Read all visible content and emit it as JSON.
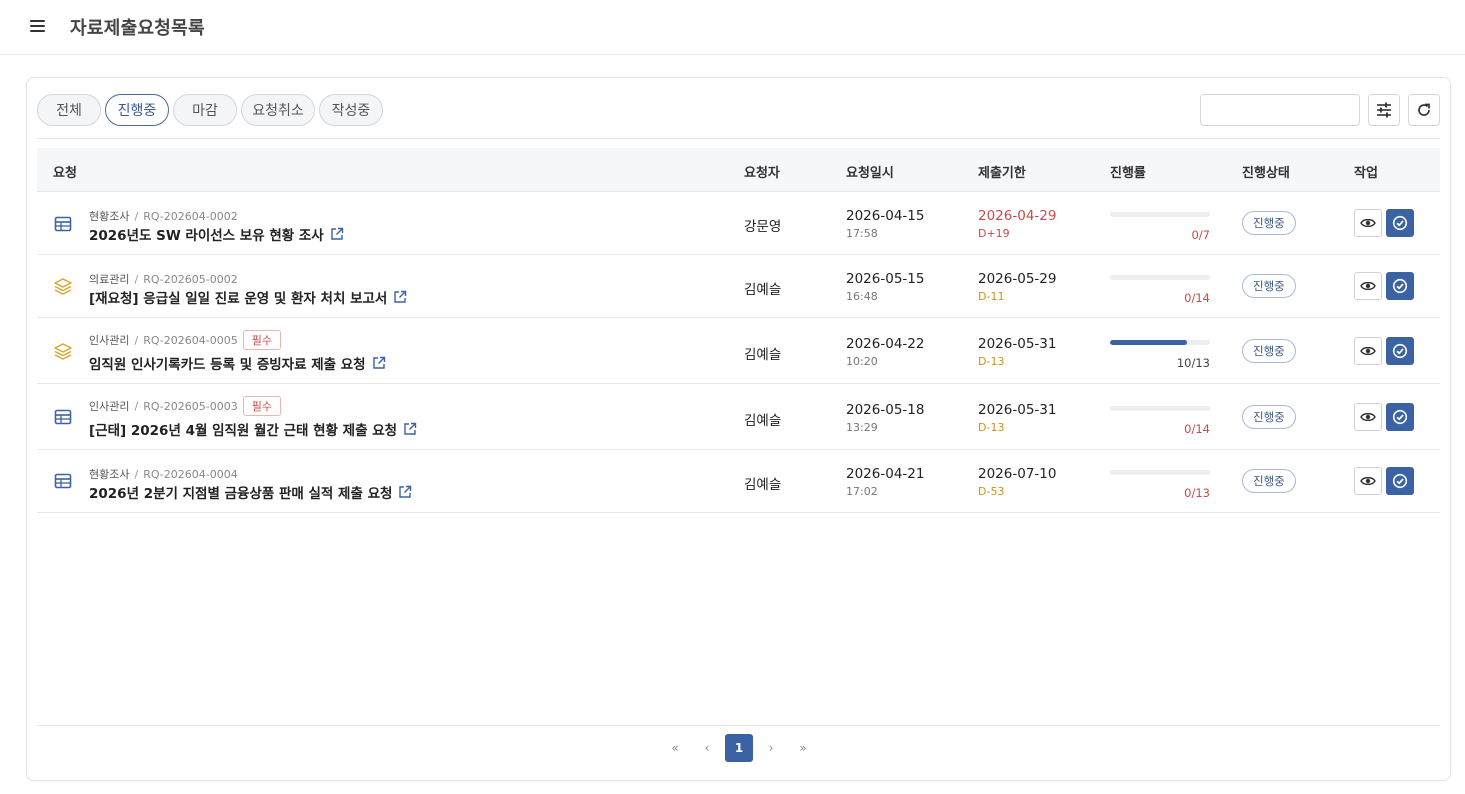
{
  "header": {
    "title": "자료제출요청목록"
  },
  "filters": [
    {
      "label": "전체",
      "active": false
    },
    {
      "label": "진행중",
      "active": true
    },
    {
      "label": "마감",
      "active": false
    },
    {
      "label": "요청취소",
      "active": false
    },
    {
      "label": "작성중",
      "active": false
    }
  ],
  "search": {
    "value": "",
    "placeholder": ""
  },
  "table": {
    "headers": {
      "request": "요청",
      "requester": "요청자",
      "requested_at": "요청일시",
      "deadline": "제출기한",
      "progress": "진행률",
      "status": "진행상태",
      "actions": "작업"
    },
    "rows": [
      {
        "icon": "table-icon",
        "category": "현황조사",
        "code": "RQ-202604-0002",
        "required": "",
        "title": "2026년도 SW 라이선스 보유 현황 조사",
        "requester": "강문영",
        "date": "2026-04-15",
        "time": "17:58",
        "deadline": "2026-04-29",
        "dday": "D+19",
        "progress_text": "0/7",
        "progress": 0,
        "status": "진행중"
      },
      {
        "icon": "layers-icon",
        "category": "의료관리",
        "code": "RQ-202605-0002",
        "required": "",
        "title": "[재요청] 응급실 일일 진료 운영 및 환자 처치 보고서",
        "requester": "김예슬",
        "date": "2026-05-15",
        "time": "16:48",
        "deadline": "2026-05-29",
        "dday": "D-11",
        "progress_text": "0/14",
        "progress": 0,
        "status": "진행중"
      },
      {
        "icon": "layers-icon",
        "category": "인사관리",
        "code": "RQ-202604-0005",
        "required": "필수",
        "title": "임직원 인사기록카드 등록 및 증빙자료 제출 요청",
        "requester": "김예슬",
        "date": "2026-04-22",
        "time": "10:20",
        "deadline": "2026-05-31",
        "dday": "D-13",
        "progress_text": "10/13",
        "progress": 0.769,
        "status": "진행중"
      },
      {
        "icon": "table-icon",
        "category": "인사관리",
        "code": "RQ-202605-0003",
        "required": "필수",
        "title": "[근태] 2026년 4월 임직원 월간 근태 현황 제출 요청",
        "requester": "김예슬",
        "date": "2026-05-18",
        "time": "13:29",
        "deadline": "2026-05-31",
        "dday": "D-13",
        "progress_text": "0/14",
        "progress": 0,
        "status": "진행중"
      },
      {
        "icon": "table-icon",
        "category": "현황조사",
        "code": "RQ-202604-0004",
        "required": "",
        "title": "2026년 2분기 지점별 금융상품 판매 실적 제출 요청",
        "requester": "김예슬",
        "date": "2026-04-21",
        "time": "17:02",
        "deadline": "2026-07-10",
        "dday": "D-53",
        "progress_text": "0/13",
        "progress": 0,
        "status": "진행중"
      }
    ]
  },
  "pagination": {
    "first": "«",
    "prev": "‹",
    "current": "1",
    "next": "›",
    "last": "»"
  },
  "colors": {
    "primary": "#3b62a3",
    "danger": "#c94a4a",
    "warning": "#c9941a",
    "table_icon": "#3b62a3",
    "layers_icon": "#d4a72c"
  }
}
